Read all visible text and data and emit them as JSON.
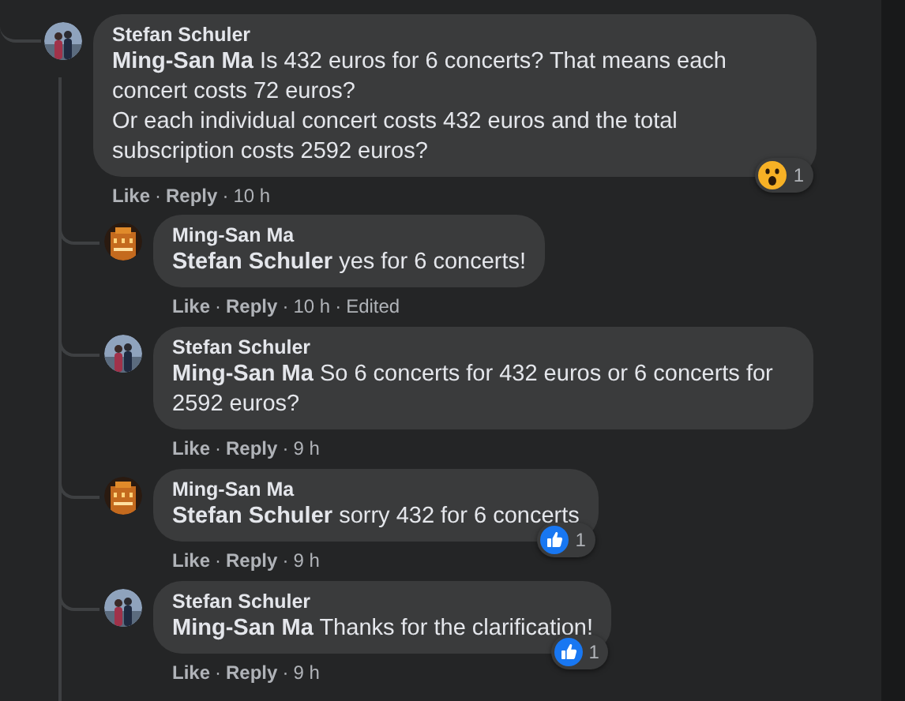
{
  "separator": "·",
  "comments": [
    {
      "author": "Stefan Schuler",
      "mention": "Ming-San Ma",
      "text": "Is 432 euros for 6 concerts? That means each concert costs 72 euros?\nOr each individual concert costs 432 euros and the total subscription costs 2592 euros?",
      "reaction": {
        "kind": "wow",
        "count": "1"
      },
      "meta": [
        {
          "text": "Like",
          "kind": "link"
        },
        {
          "text": "Reply",
          "kind": "link"
        },
        {
          "text": "10 h",
          "kind": "plain"
        }
      ],
      "children": [
        {
          "author": "Ming-San Ma",
          "mention": "Stefan Schuler",
          "text": "yes for 6 concerts!",
          "meta": [
            {
              "text": "Like",
              "kind": "link"
            },
            {
              "text": "Reply",
              "kind": "link"
            },
            {
              "text": "10 h",
              "kind": "plain"
            },
            {
              "text": "Edited",
              "kind": "plain"
            }
          ]
        },
        {
          "author": "Stefan Schuler",
          "mention": "Ming-San Ma",
          "text": "So 6 concerts for 432 euros or 6 concerts for 2592 euros?",
          "meta": [
            {
              "text": "Like",
              "kind": "link"
            },
            {
              "text": "Reply",
              "kind": "link"
            },
            {
              "text": "9 h",
              "kind": "plain"
            }
          ]
        },
        {
          "author": "Ming-San Ma",
          "mention": "Stefan Schuler",
          "text": "sorry 432 for 6 concerts",
          "reaction": {
            "kind": "like",
            "count": "1"
          },
          "meta": [
            {
              "text": "Like",
              "kind": "link"
            },
            {
              "text": "Reply",
              "kind": "link"
            },
            {
              "text": "9 h",
              "kind": "plain"
            }
          ]
        },
        {
          "author": "Stefan Schuler",
          "mention": "Ming-San Ma",
          "text": "Thanks for the clarification!",
          "reaction": {
            "kind": "like",
            "count": "1"
          },
          "meta": [
            {
              "text": "Like",
              "kind": "link"
            },
            {
              "text": "Reply",
              "kind": "link"
            },
            {
              "text": "9 h",
              "kind": "plain"
            }
          ]
        }
      ]
    }
  ]
}
